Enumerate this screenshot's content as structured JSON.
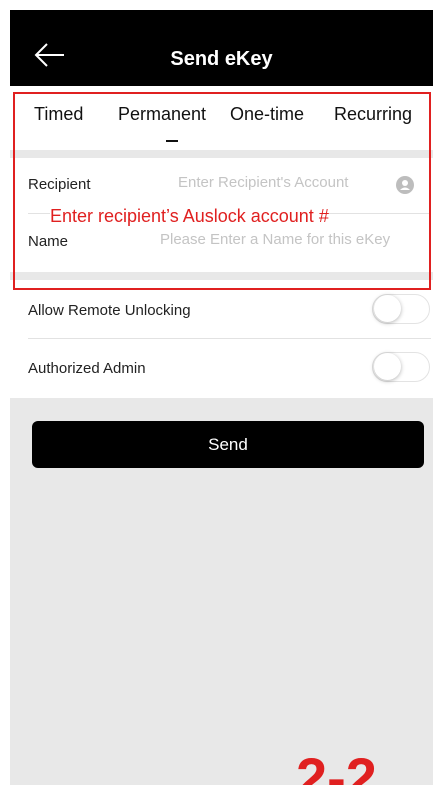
{
  "header": {
    "title": "Send eKey"
  },
  "tabs": [
    {
      "label": "Timed",
      "selected": false
    },
    {
      "label": "Permanent",
      "selected": true
    },
    {
      "label": "One-time",
      "selected": false
    },
    {
      "label": "Recurring",
      "selected": false
    }
  ],
  "form": {
    "recipient": {
      "label": "Recipient",
      "placeholder": "Enter Recipient's Account"
    },
    "name": {
      "label": "Name",
      "placeholder": "Please Enter a Name for this eKey"
    }
  },
  "annotation": {
    "text": "Enter recipient’s Auslock account #"
  },
  "switches": [
    {
      "label": "Allow Remote Unlocking",
      "on": false
    },
    {
      "label": "Authorized Admin",
      "on": false
    }
  ],
  "send_button": {
    "label": "Send"
  },
  "corner_label": "2-2",
  "colors": {
    "annotation": "#e02020",
    "accent": "#000000",
    "background": "#e8e8e8"
  }
}
